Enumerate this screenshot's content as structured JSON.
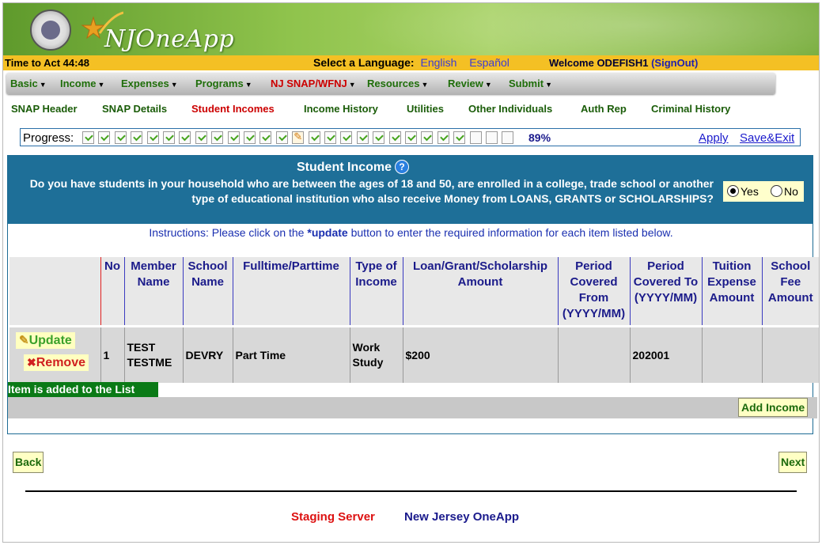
{
  "header": {
    "app_name": "NJOneApp",
    "timer": "Time to Act 44:48",
    "language_label": "Select a Language:",
    "languages": [
      "English",
      "Español"
    ],
    "welcome": "Welcome ODEFISH1",
    "signout": "(SignOut)"
  },
  "menu": {
    "items": [
      "Basic",
      "Income",
      "Expenses",
      "Programs",
      "NJ SNAP/WFNJ",
      "Resources",
      "Review",
      "Submit"
    ],
    "active": "NJ SNAP/WFNJ"
  },
  "subnav": {
    "items": [
      "SNAP Header",
      "SNAP Details",
      "Student Incomes",
      "Income History",
      "Utilities",
      "Other Individuals",
      "Auth Rep",
      "Criminal History"
    ],
    "active": "Student Incomes"
  },
  "progress": {
    "label": "Progress:",
    "percent": "89%",
    "steps_total": 27,
    "steps_done": 23,
    "current_step": 13,
    "apply": "Apply",
    "save_exit": "Save&Exit"
  },
  "question": {
    "title": "Student Income",
    "text": "Do you have students in your household who are between the ages of 18 and 50, are enrolled in a college, trade school or another type of educational institution who also receive Money from LOANS, GRANTS or SCHOLARSHIPS?",
    "yes": "Yes",
    "no": "No",
    "selected": "Yes"
  },
  "instructions": {
    "before": "Instructions: Please click on the ",
    "highlight": "*update",
    "after": " button to enter the required information for each item listed below."
  },
  "table": {
    "headers": [
      "",
      "No",
      "Member Name",
      "School Name",
      "Fulltime/Parttime",
      "Type of Income",
      "Loan/Grant/Scholarship Amount",
      "Period Covered From (YYYY/MM)",
      "Period Covered To (YYYY/MM)",
      "Tuition Expense Amount",
      "School Fee Amount"
    ],
    "rows": [
      {
        "update": "Update",
        "remove": "Remove",
        "no": "1",
        "member": "TEST TESTME",
        "school": "DEVRY",
        "time": "Part Time",
        "type": "Work Study",
        "amount": "$200",
        "from": "",
        "to": "202001",
        "tuition": "",
        "fee": ""
      }
    ]
  },
  "status_message": "Item is added to the List",
  "buttons": {
    "add_income": "Add Income",
    "back": "Back",
    "next": "Next"
  },
  "footer": {
    "server": "Staging Server",
    "app": "New Jersey OneApp"
  },
  "colors": {
    "banner_green": "#8fc34c",
    "bar_gold": "#f4c024",
    "section_blue": "#1e6f98",
    "active_red": "#cc0000",
    "link_blue": "#1a1acc"
  }
}
